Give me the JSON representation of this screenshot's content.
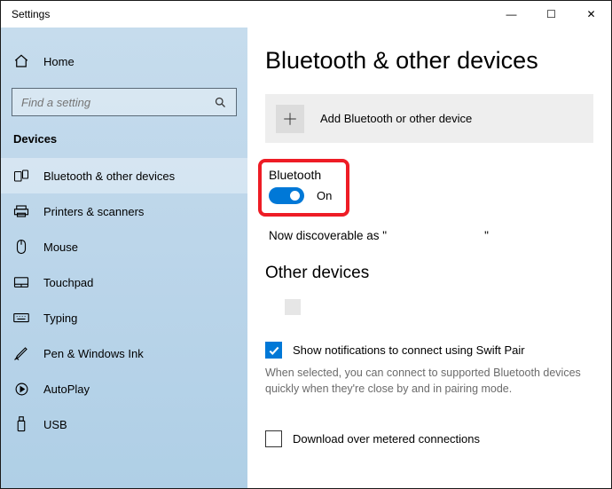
{
  "window": {
    "title": "Settings",
    "controls": {
      "min": "—",
      "max": "☐",
      "close": "✕"
    }
  },
  "sidebar": {
    "home_label": "Home",
    "search_placeholder": "Find a setting",
    "section": "Devices",
    "items": [
      {
        "label": "Bluetooth & other devices",
        "icon": "bluetooth",
        "selected": true
      },
      {
        "label": "Printers & scanners",
        "icon": "printer",
        "selected": false
      },
      {
        "label": "Mouse",
        "icon": "mouse",
        "selected": false
      },
      {
        "label": "Touchpad",
        "icon": "touchpad",
        "selected": false
      },
      {
        "label": "Typing",
        "icon": "keyboard",
        "selected": false
      },
      {
        "label": "Pen & Windows Ink",
        "icon": "pen",
        "selected": false
      },
      {
        "label": "AutoPlay",
        "icon": "autoplay",
        "selected": false
      },
      {
        "label": "USB",
        "icon": "usb",
        "selected": false
      }
    ]
  },
  "main": {
    "title": "Bluetooth & other devices",
    "add_label": "Add Bluetooth or other device",
    "bt_heading": "Bluetooth",
    "bt_state": "On",
    "discoverable_prefix": "Now discoverable as \"",
    "discoverable_suffix": "\"",
    "other_heading": "Other devices",
    "swift_pair_label": "Show notifications to connect using Swift Pair",
    "swift_pair_help": "When selected, you can connect to supported Bluetooth devices quickly when they're close by and in pairing mode.",
    "metered_label": "Download over metered connections"
  },
  "colors": {
    "accent": "#0078d7",
    "highlight": "#ee1c25"
  }
}
